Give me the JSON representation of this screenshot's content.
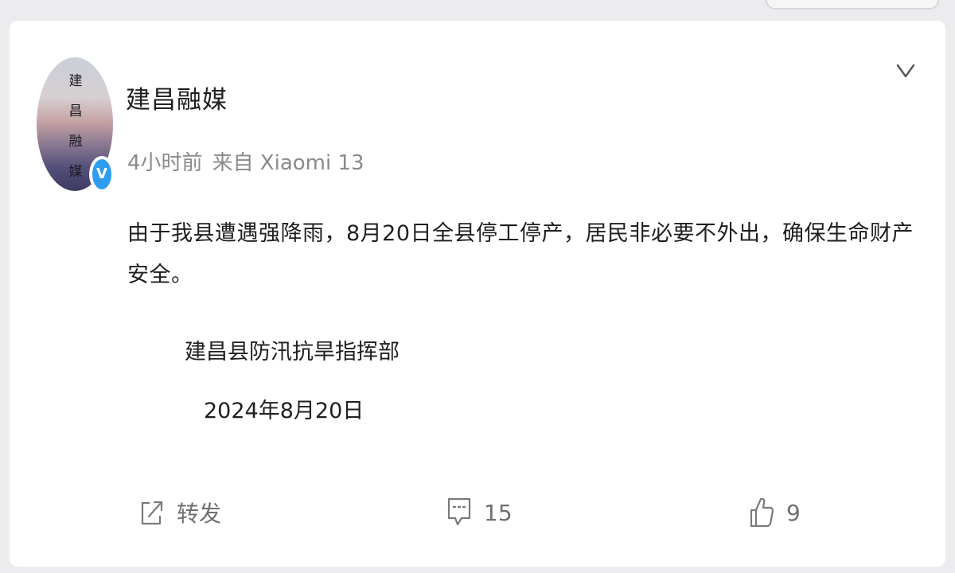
{
  "post": {
    "author": "建昌融媒",
    "avatar_text": [
      "建",
      "昌",
      "融",
      "媒"
    ],
    "verified_badge": "V",
    "time": "4小时前",
    "source": "来自 Xiaomi 13",
    "content_line1": "由于我县遭遇强降雨，8月20日全县停工停产，居民非必要不外出，确保生命财产",
    "content_line2": "安全。",
    "signature": "建昌县防汛抗旱指挥部",
    "date": "2024年8月20日"
  },
  "actions": {
    "repost_label": "转发",
    "comment_count": "15",
    "like_count": "9"
  },
  "icons": {
    "menu": "chevron-down-icon",
    "repost": "share-icon",
    "comment": "comment-icon",
    "like": "thumbs-up-icon",
    "verified": "verified-badge-icon"
  },
  "colors": {
    "verified_blue": "#2e9cf0",
    "text_primary": "#1f1f1f",
    "text_meta": "#8a8a8a",
    "action_gray": "#6f6f6f"
  }
}
